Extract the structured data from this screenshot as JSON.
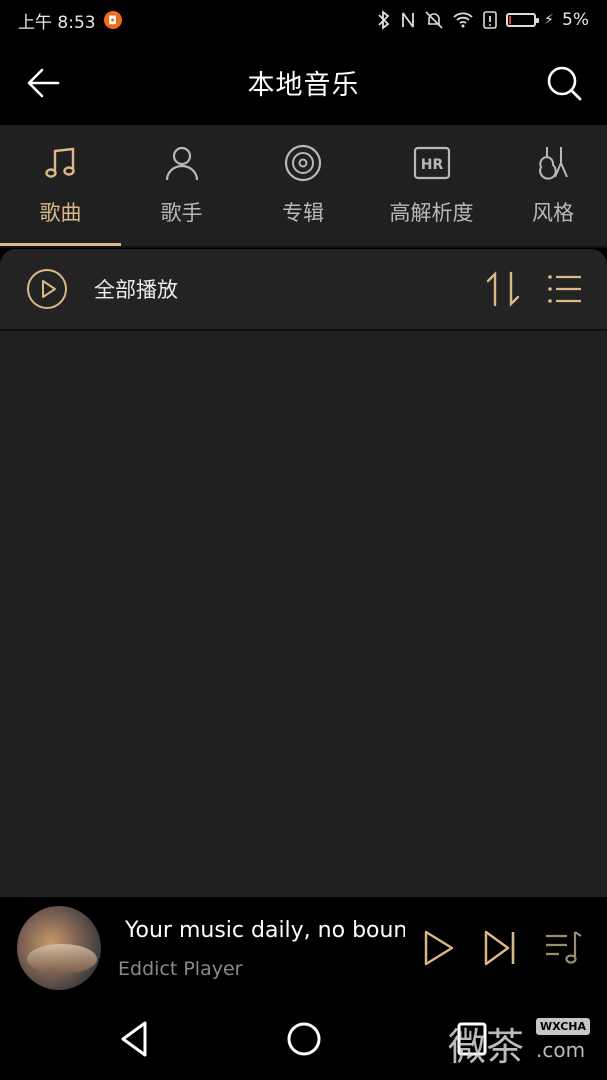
{
  "status": {
    "time": "上午 8:53",
    "battery": "5%",
    "battery_level": 0.05,
    "battery_color": "#e53935"
  },
  "header": {
    "title": "本地音乐",
    "back_icon": "arrow-left-icon",
    "search_icon": "search-icon"
  },
  "tabs": [
    {
      "label": "歌曲",
      "icon": "music-note-icon",
      "active": true
    },
    {
      "label": "歌手",
      "icon": "person-icon",
      "active": false
    },
    {
      "label": "专辑",
      "icon": "disc-icon",
      "active": false
    },
    {
      "label": "高解析度",
      "icon": "hr-badge-icon",
      "active": false
    },
    {
      "label": "风格",
      "icon": "guitar-icon",
      "active": false
    }
  ],
  "accent_color": "#d9b98a",
  "play_all": {
    "label": "全部播放"
  },
  "mini_player": {
    "title": "Your music daily, no bound",
    "artist": "Eddict Player"
  },
  "watermark": {
    "text": "微茶",
    "tag": "WXCHA",
    "domain": ".com"
  }
}
